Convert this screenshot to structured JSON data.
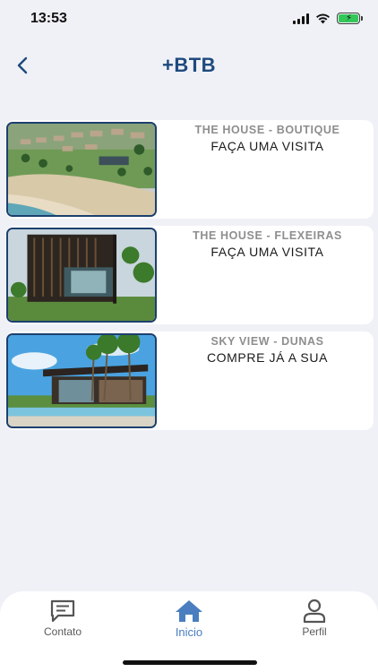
{
  "status_bar": {
    "time": "13:53"
  },
  "header": {
    "title": "+BTB"
  },
  "cards": [
    {
      "title": "THE HOUSE - BOUTIQUE",
      "subtitle": "FAÇA UMA VISITA"
    },
    {
      "title": "THE HOUSE - FLEXEIRAS",
      "subtitle": "FAÇA UMA VISITA"
    },
    {
      "title": "SKY VIEW - DUNAS",
      "subtitle": "COMPRE JÁ A SUA"
    }
  ],
  "tab_bar": {
    "items": [
      {
        "label": "Contato",
        "icon": "chat-icon"
      },
      {
        "label": "Inicio",
        "icon": "home-icon",
        "active": true
      },
      {
        "label": "Perfil",
        "icon": "person-icon"
      }
    ]
  },
  "colors": {
    "accent": "#1e4a7e",
    "active_tab": "#4a7ec0",
    "background": "#f0f1f6"
  }
}
